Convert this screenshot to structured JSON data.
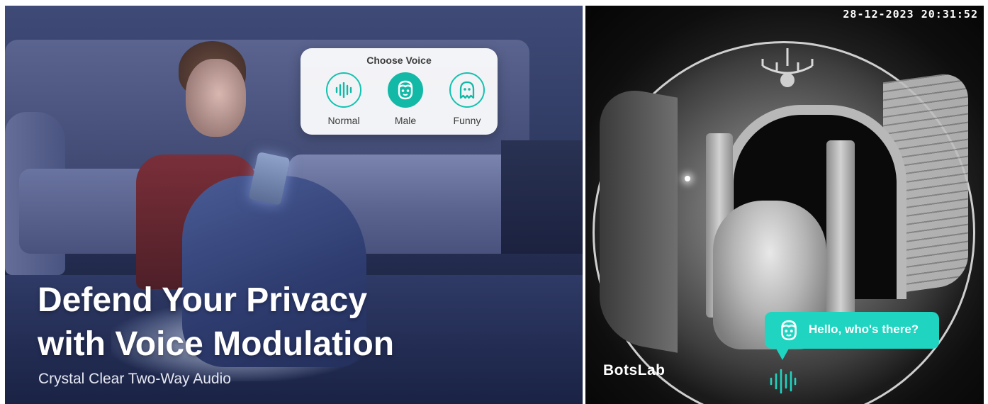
{
  "left_panel": {
    "voice_card": {
      "title": "Choose Voice",
      "options": [
        {
          "label": "Normal",
          "icon": "voice-wave-icon",
          "selected": false
        },
        {
          "label": "Male",
          "icon": "male-face-icon",
          "selected": true
        },
        {
          "label": "Funny",
          "icon": "ghost-icon",
          "selected": false
        }
      ]
    },
    "headline": {
      "line1": "Defend Your Privacy",
      "line2": "with Voice Modulation"
    },
    "subhead": "Crystal Clear Two-Way Audio"
  },
  "right_panel": {
    "timestamp": "28-12-2023 20:31:52",
    "speech_bubble": {
      "text": "Hello, who's there?",
      "icon": "male-face-icon"
    },
    "brand": "BotsLab",
    "audio_icon": "audio-wave-icon"
  },
  "colors": {
    "accent": "#12b9a6",
    "bubble": "#1fd4c0",
    "card_bg": "#ffffff"
  }
}
